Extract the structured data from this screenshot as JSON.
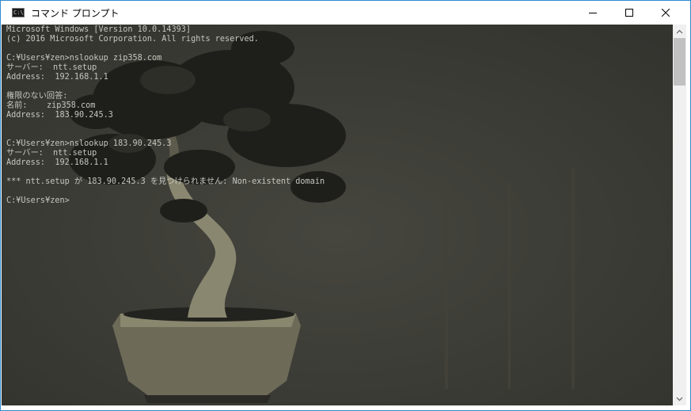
{
  "window": {
    "title": "コマンド プロンプト",
    "icon_label": "C:\\",
    "buttons": {
      "minimize": "minimize-icon",
      "maximize": "maximize-icon",
      "close": "close-icon"
    }
  },
  "console": {
    "lines": [
      "Microsoft Windows [Version 10.0.14393]",
      "(c) 2016 Microsoft Corporation. All rights reserved.",
      "",
      "C:¥Users¥zen>nslookup zip358.com",
      "サーバー:  ntt.setup",
      "Address:  192.168.1.1",
      "",
      "権限のない回答:",
      "名前:    zip358.com",
      "Address:  183.90.245.3",
      "",
      "",
      "C:¥Users¥zen>nslookup 183.90.245.3",
      "サーバー:  ntt.setup",
      "Address:  192.168.1.1",
      "",
      "*** ntt.setup が 183.90.245.3 を見つけられません: Non-existent domain",
      "",
      "C:¥Users¥zen>"
    ],
    "colors": {
      "background": "#3e3e39",
      "text": "#c6c6c0"
    }
  },
  "scrollbar": {
    "up_icon": "scroll-up-icon",
    "down_icon": "scroll-down-icon"
  }
}
